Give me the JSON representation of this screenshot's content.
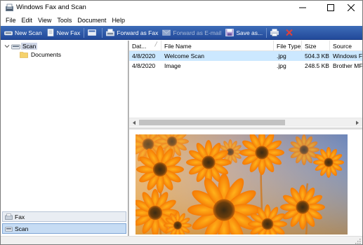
{
  "window": {
    "title": "Windows Fax and Scan",
    "controls": [
      "minimize",
      "maximize",
      "close"
    ]
  },
  "menu": [
    "File",
    "Edit",
    "View",
    "Tools",
    "Document",
    "Help"
  ],
  "toolbar": {
    "new_scan": "New Scan",
    "new_fax": "New Fax",
    "forward_as_fax": "Forward as Fax",
    "forward_as_email": "Forward as E-mail",
    "save_as": "Save as..."
  },
  "tree": {
    "root": "Scan",
    "children": [
      "Documents"
    ]
  },
  "nav": {
    "fax": "Fax",
    "scan": "Scan"
  },
  "list": {
    "columns": [
      "Dat...",
      "File Name",
      "File Type",
      "Size",
      "Source"
    ],
    "rows": [
      {
        "date": "4/8/2020",
        "name": "Welcome Scan",
        "type": ".jpg",
        "size": "504.3 KB",
        "source": "Windows Fa",
        "selected": true
      },
      {
        "date": "4/8/2020",
        "name": "Image",
        "type": ".jpg",
        "size": "248.5 KB",
        "source": "Brother MFC",
        "selected": false
      }
    ]
  },
  "colors": {
    "toolbar": "#2c57a8",
    "selection": "#cce8ff",
    "nav_selected": "#c6dcf4",
    "flowers": "#f7a60c"
  },
  "preview": {
    "subject": "orange-daisies-photo"
  }
}
